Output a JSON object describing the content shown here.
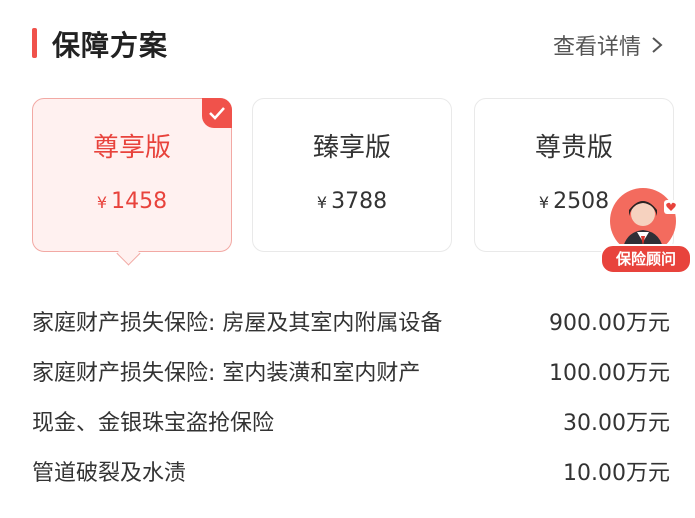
{
  "header": {
    "title": "保障方案",
    "more_label": "查看详情"
  },
  "plans": [
    {
      "name": "尊享版",
      "currency": "¥",
      "price": "1458",
      "selected": true
    },
    {
      "name": "臻享版",
      "currency": "¥",
      "price": "3788",
      "selected": false
    },
    {
      "name": "尊贵版",
      "currency": "¥",
      "price": "2508",
      "selected": false
    }
  ],
  "advisor": {
    "label": "保险顾问"
  },
  "coverage": [
    {
      "label": "家庭财产损失保险: 房屋及其室内附属设备",
      "value": "900.00万元"
    },
    {
      "label": "家庭财产损失保险: 室内装潢和室内财产",
      "value": "100.00万元"
    },
    {
      "label": "现金、金银珠宝盗抢保险",
      "value": "30.00万元"
    },
    {
      "label": "管道破裂及水渍",
      "value": "10.00万元"
    }
  ],
  "colors": {
    "accent": "#f0524b",
    "selected_bg": "#fff1f0",
    "text": "#333333"
  }
}
